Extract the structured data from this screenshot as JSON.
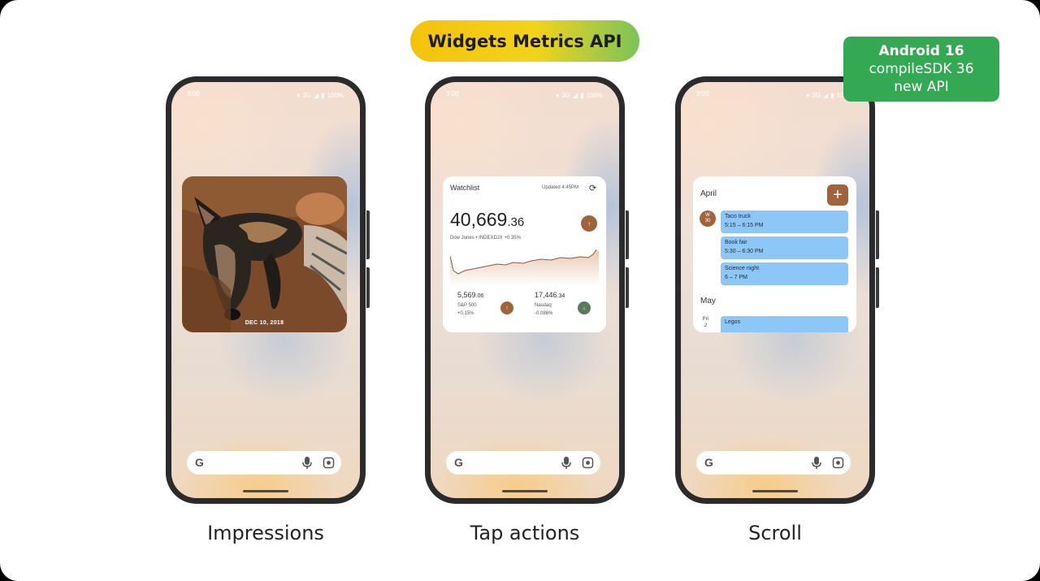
{
  "title": "Widgets Metrics API",
  "badge": {
    "line1": "Android 16",
    "line2": "compileSDK 36",
    "line3": "new API"
  },
  "status_bar": {
    "time": "3:00",
    "network": "3G",
    "battery": "100%"
  },
  "phones": [
    {
      "caption": "Impressions",
      "photo_date": "DEC 10, 2018"
    },
    {
      "caption": "Tap actions",
      "watchlist": {
        "title": "Watchlist",
        "updated": "Updated 4:45PM",
        "value_main": "40,669",
        "value_dec": ".36",
        "subtitle": "Dow Jones • INDEXDJX +0.35%",
        "sp_value": "5,569",
        "sp_dec": ".06",
        "sp_name": "S&P 500",
        "sp_change": "+0.15%",
        "nasdaq_value": "17,446",
        "nasdaq_dec": ".34",
        "nasdaq_name": "Nasdaq",
        "nasdaq_change": "-0.086%"
      }
    },
    {
      "caption": "Scroll",
      "calendar": {
        "month1": "April",
        "day1_weekday": "W",
        "day1_num": "30",
        "events": [
          {
            "title": "Taco truck",
            "time": "5:15 – 6:15 PM"
          },
          {
            "title": "Book fair",
            "time": "5:30 – 6:30 PM"
          },
          {
            "title": "Science night",
            "time": "6 – 7 PM"
          }
        ],
        "month2": "May",
        "day2_weekday": "Fri",
        "day2_num": "2",
        "event4_title": "Legos"
      }
    }
  ],
  "icons": [
    "google-g-icon",
    "mic-icon",
    "lens-icon",
    "refresh-icon",
    "arrow-up-icon",
    "arrow-down-icon",
    "plus-icon"
  ],
  "colors": {
    "accent_brown": "#a0643c",
    "badge_green": "#34a853",
    "event_blue": "#8cc7f8",
    "down_green": "#5b7a5a"
  }
}
